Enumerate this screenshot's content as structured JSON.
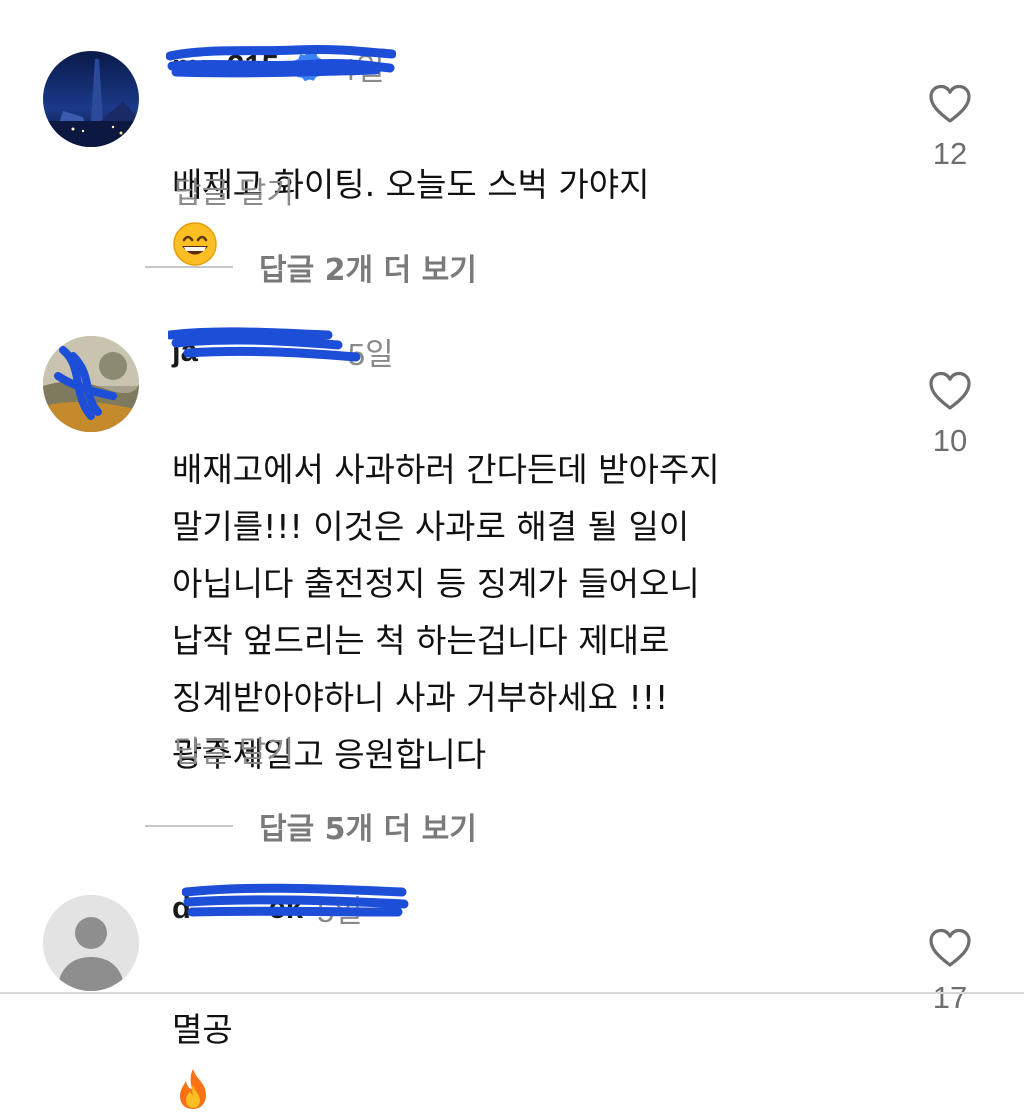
{
  "comments": [
    {
      "username": "mu 315",
      "time": "4일",
      "verified": true,
      "text": "배재고 화이팅.  오늘도 스벅 가야지",
      "emoji": "grinning-face",
      "reply_label": "답글 달기",
      "likes": "12",
      "more_replies": "답글 2개 더 보기"
    },
    {
      "username": "ja",
      "time": "5일",
      "verified": false,
      "text": "배재고에서 사과하러 간다든데 받아주지\n말기를!!! 이것은 사과로 해결 될 일이\n아닙니다 출전정지 등 징계가 들어오니\n납작 엎드리는 척 하는겁니다 제대로\n징계받아야하니 사과 거부하세요 !!!\n광주제일고 응원합니다",
      "reply_label": "답글 달기",
      "likes": "10",
      "more_replies": "답글 5개 더 보기"
    },
    {
      "username": "d         ek",
      "time": "5일",
      "verified": false,
      "text": "멸공",
      "emoji": "fire",
      "likes": "17"
    }
  ],
  "colors": {
    "verified_blue": "#3b82f6",
    "secondary_text": "#8a8a8a",
    "redaction_scribble": "#1d4ed8"
  },
  "icons": {
    "like": "heart-outline-icon",
    "verified": "verified-badge-icon",
    "default_avatar": "default-user-avatar-icon"
  }
}
